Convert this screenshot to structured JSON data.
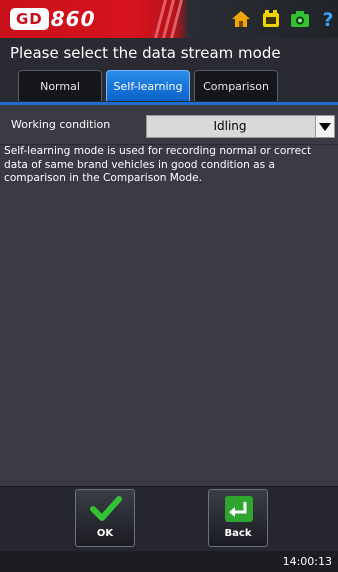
{
  "brand": {
    "logo_prefix": "GD",
    "logo_number": "860",
    "color": "#c8101a"
  },
  "top_icons": [
    {
      "name": "home-icon",
      "color": "#f2a400"
    },
    {
      "name": "swap-icon",
      "color": "#f2d200"
    },
    {
      "name": "camera-icon",
      "color": "#33c033"
    },
    {
      "name": "help-icon",
      "color": "#3aa0ff"
    }
  ],
  "header": {
    "title": "Please select the data stream mode"
  },
  "tabs": [
    {
      "label": "Normal",
      "active": false
    },
    {
      "label": "Self-learning",
      "active": true
    },
    {
      "label": "Comparison",
      "active": false
    }
  ],
  "working_condition": {
    "label": "Working condition",
    "selected": "Idling"
  },
  "description": "Self-learning mode is used for recording normal or correct data of same brand vehicles in good condition as a comparison in the Comparison Mode.",
  "buttons": {
    "ok_label": "OK",
    "back_label": "Back"
  },
  "status": {
    "time": "14:00:13"
  }
}
